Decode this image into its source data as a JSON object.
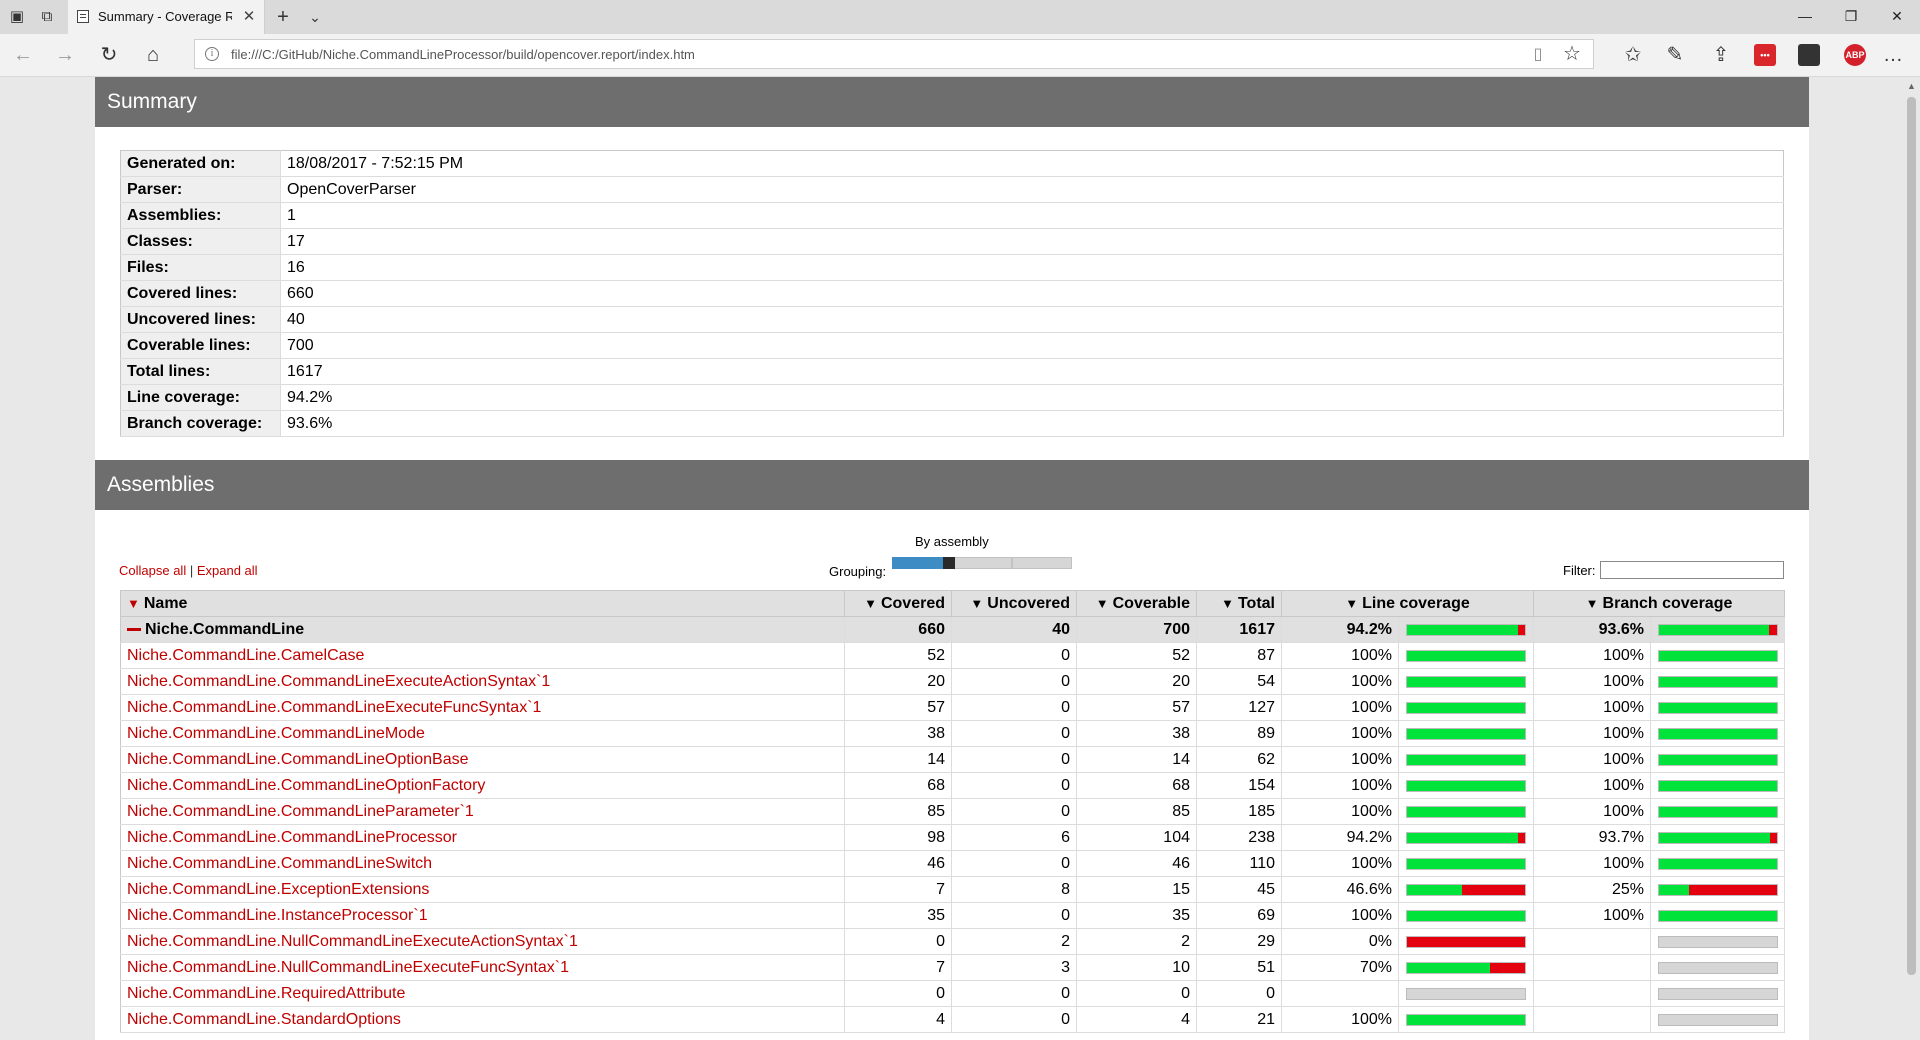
{
  "browser": {
    "tab_title": "Summary - Coverage Report",
    "url": "file:///C:/GitHub/Niche.CommandLineProcessor/build/opencover.report/index.htm",
    "extensions": [
      {
        "name": "ext-red-badge",
        "label": "•••",
        "color": "#d9262b"
      },
      {
        "name": "pocket-icon",
        "label": "",
        "color": "#333333"
      },
      {
        "name": "adblock-icon",
        "label": "ABP",
        "color": "#d4202a"
      }
    ]
  },
  "summary": {
    "title": "Summary",
    "rows": [
      {
        "key": "Generated on:",
        "value": "18/08/2017 - 7:52:15 PM"
      },
      {
        "key": "Parser:",
        "value": "OpenCoverParser"
      },
      {
        "key": "Assemblies:",
        "value": "1"
      },
      {
        "key": "Classes:",
        "value": "17"
      },
      {
        "key": "Files:",
        "value": "16"
      },
      {
        "key": "Covered lines:",
        "value": "660"
      },
      {
        "key": "Uncovered lines:",
        "value": "40"
      },
      {
        "key": "Coverable lines:",
        "value": "700"
      },
      {
        "key": "Total lines:",
        "value": "1617"
      },
      {
        "key": "Line coverage:",
        "value": "94.2%"
      },
      {
        "key": "Branch coverage:",
        "value": "93.6%"
      }
    ]
  },
  "assemblies": {
    "title": "Assemblies",
    "collapse_all": "Collapse all",
    "expand_all": "Expand all",
    "grouping_value": "By assembly",
    "grouping_label": "Grouping:",
    "grouping_fraction": 0.33,
    "filter_label": "Filter:",
    "filter_value": "",
    "columns": {
      "name": "Name",
      "covered": "Covered",
      "uncovered": "Uncovered",
      "coverable": "Coverable",
      "total": "Total",
      "line_coverage": "Line coverage",
      "branch_coverage": "Branch coverage"
    },
    "assembly_row": {
      "name": "Niche.CommandLine",
      "covered": "660",
      "uncovered": "40",
      "coverable": "700",
      "total": "1617",
      "line": "94.2%",
      "line_frac": 0.942,
      "branch": "93.6%",
      "branch_frac": 0.936
    },
    "classes": [
      {
        "name": "Niche.CommandLine.CamelCase",
        "covered": "52",
        "uncovered": "0",
        "coverable": "52",
        "total": "87",
        "line": "100%",
        "line_frac": 1,
        "branch": "100%",
        "branch_frac": 1
      },
      {
        "name": "Niche.CommandLine.CommandLineExecuteActionSyntax`1",
        "covered": "20",
        "uncovered": "0",
        "coverable": "20",
        "total": "54",
        "line": "100%",
        "line_frac": 1,
        "branch": "100%",
        "branch_frac": 1
      },
      {
        "name": "Niche.CommandLine.CommandLineExecuteFuncSyntax`1",
        "covered": "57",
        "uncovered": "0",
        "coverable": "57",
        "total": "127",
        "line": "100%",
        "line_frac": 1,
        "branch": "100%",
        "branch_frac": 1
      },
      {
        "name": "Niche.CommandLine.CommandLineMode",
        "covered": "38",
        "uncovered": "0",
        "coverable": "38",
        "total": "89",
        "line": "100%",
        "line_frac": 1,
        "branch": "100%",
        "branch_frac": 1
      },
      {
        "name": "Niche.CommandLine.CommandLineOptionBase",
        "covered": "14",
        "uncovered": "0",
        "coverable": "14",
        "total": "62",
        "line": "100%",
        "line_frac": 1,
        "branch": "100%",
        "branch_frac": 1
      },
      {
        "name": "Niche.CommandLine.CommandLineOptionFactory",
        "covered": "68",
        "uncovered": "0",
        "coverable": "68",
        "total": "154",
        "line": "100%",
        "line_frac": 1,
        "branch": "100%",
        "branch_frac": 1
      },
      {
        "name": "Niche.CommandLine.CommandLineParameter`1",
        "covered": "85",
        "uncovered": "0",
        "coverable": "85",
        "total": "185",
        "line": "100%",
        "line_frac": 1,
        "branch": "100%",
        "branch_frac": 1
      },
      {
        "name": "Niche.CommandLine.CommandLineProcessor",
        "covered": "98",
        "uncovered": "6",
        "coverable": "104",
        "total": "238",
        "line": "94.2%",
        "line_frac": 0.942,
        "branch": "93.7%",
        "branch_frac": 0.937
      },
      {
        "name": "Niche.CommandLine.CommandLineSwitch",
        "covered": "46",
        "uncovered": "0",
        "coverable": "46",
        "total": "110",
        "line": "100%",
        "line_frac": 1,
        "branch": "100%",
        "branch_frac": 1
      },
      {
        "name": "Niche.CommandLine.ExceptionExtensions",
        "covered": "7",
        "uncovered": "8",
        "coverable": "15",
        "total": "45",
        "line": "46.6%",
        "line_frac": 0.466,
        "branch": "25%",
        "branch_frac": 0.25
      },
      {
        "name": "Niche.CommandLine.InstanceProcessor`1",
        "covered": "35",
        "uncovered": "0",
        "coverable": "35",
        "total": "69",
        "line": "100%",
        "line_frac": 1,
        "branch": "100%",
        "branch_frac": 1
      },
      {
        "name": "Niche.CommandLine.NullCommandLineExecuteActionSyntax`1",
        "covered": "0",
        "uncovered": "2",
        "coverable": "2",
        "total": "29",
        "line": "0%",
        "line_frac": 0,
        "branch": "",
        "branch_frac": null
      },
      {
        "name": "Niche.CommandLine.NullCommandLineExecuteFuncSyntax`1",
        "covered": "7",
        "uncovered": "3",
        "coverable": "10",
        "total": "51",
        "line": "70%",
        "line_frac": 0.7,
        "branch": "",
        "branch_frac": null
      },
      {
        "name": "Niche.CommandLine.RequiredAttribute",
        "covered": "0",
        "uncovered": "0",
        "coverable": "0",
        "total": "0",
        "line": "",
        "line_frac": null,
        "branch": "",
        "branch_frac": null
      },
      {
        "name": "Niche.CommandLine.StandardOptions",
        "covered": "4",
        "uncovered": "0",
        "coverable": "4",
        "total": "21",
        "line": "100%",
        "line_frac": 1,
        "branch": "",
        "branch_frac": null
      }
    ]
  }
}
